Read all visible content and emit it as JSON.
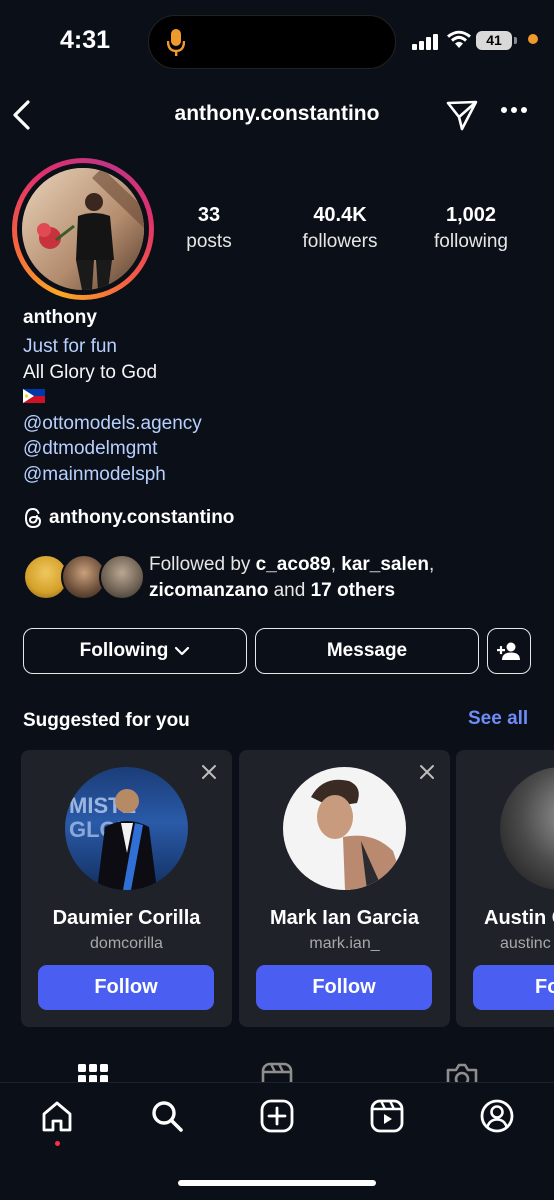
{
  "status": {
    "time": "4:31",
    "battery": "41"
  },
  "header": {
    "username": "anthony.constantino"
  },
  "stats": [
    {
      "value": "33",
      "label": "posts"
    },
    {
      "value": "40.4K",
      "label": "followers"
    },
    {
      "value": "1,002",
      "label": "following"
    }
  ],
  "bio": {
    "name": "anthony",
    "category": "Just for fun",
    "line1": "All Glory to God",
    "flag": "🇵🇭",
    "mention1": "@ottomodels.agency",
    "mention2": "@dtmodelmgmt",
    "mention3": "@mainmodelsph"
  },
  "threads": {
    "handle": "anthony.constantino"
  },
  "followed_by": {
    "prefix": "Followed by ",
    "user1": "c_aco89",
    "sep1": ", ",
    "user2": "kar_salen",
    "sep2": ",",
    "user3": "zicomanzano",
    "middle": " and ",
    "others": "17 others"
  },
  "actions": {
    "following": "Following",
    "message": "Message"
  },
  "suggested": {
    "title": "Suggested for you",
    "see_all": "See all",
    "cards": [
      {
        "name": "Daumier Corilla",
        "handle": "domcorilla",
        "button": "Follow"
      },
      {
        "name": "Mark Ian Garcia",
        "handle": "mark.ian_",
        "button": "Follow"
      },
      {
        "name": "Austin C",
        "handle": "austinc",
        "button": "Fo"
      }
    ]
  },
  "colors": {
    "accent": "#4a5ff2",
    "link": "#b7d0ff",
    "see_all": "#6e8cf5",
    "background": "#0b0f17"
  }
}
